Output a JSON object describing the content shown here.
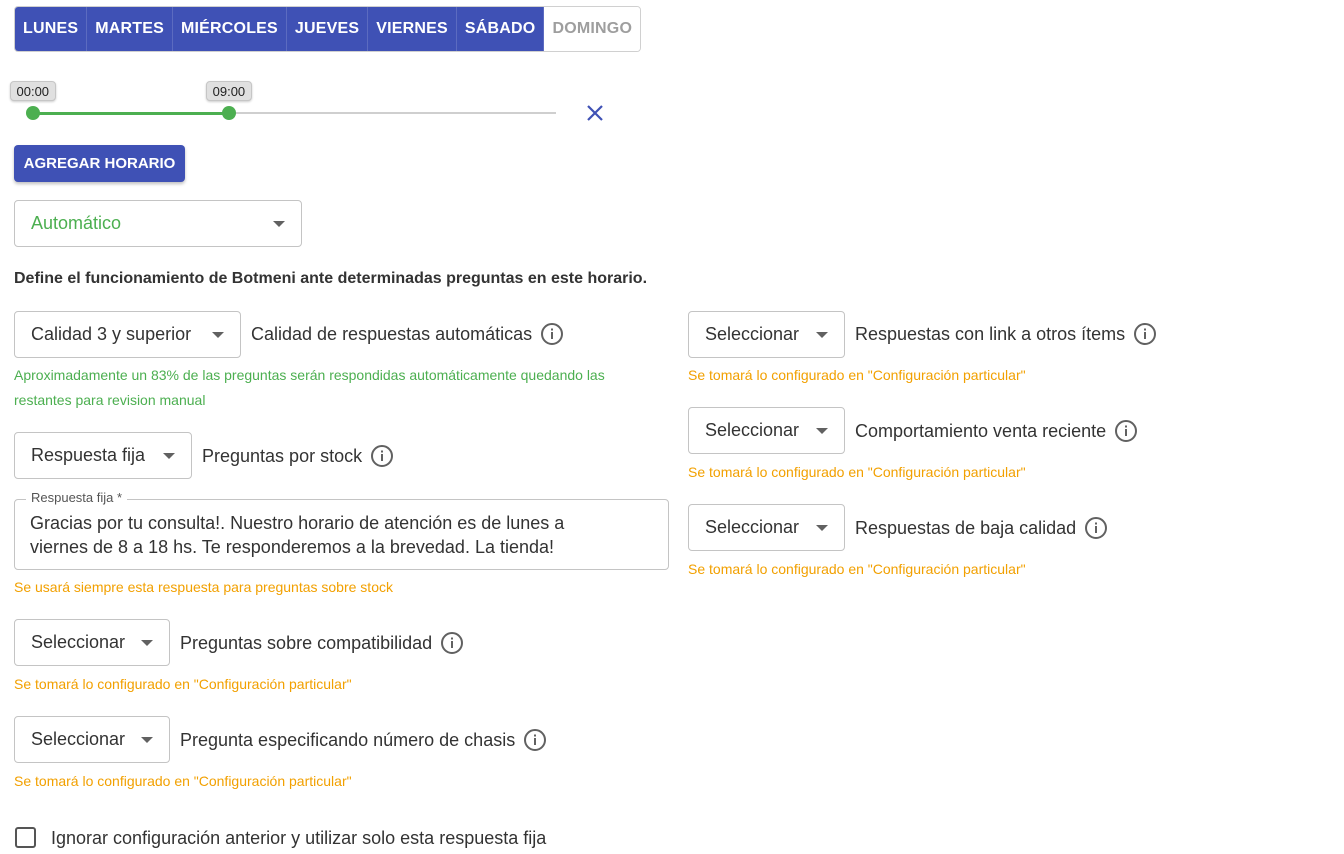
{
  "days": [
    {
      "label": "LUNES",
      "active": true
    },
    {
      "label": "MARTES",
      "active": true
    },
    {
      "label": "MIÉRCOLES",
      "active": true
    },
    {
      "label": "JUEVES",
      "active": true
    },
    {
      "label": "VIERNES",
      "active": true
    },
    {
      "label": "SÁBADO",
      "active": true
    },
    {
      "label": "DOMINGO",
      "active": false
    }
  ],
  "slider": {
    "start_label": "00:00",
    "end_label": "09:00",
    "start_fraction": 0.0,
    "end_fraction": 0.375
  },
  "add_schedule_label": "AGREGAR HORARIO",
  "mode_select": {
    "value": "Automático"
  },
  "description": "Define el funcionamiento de Botmeni ante determinadas preguntas en este horario.",
  "quality": {
    "select_value": "Calidad 3 y superior",
    "label": "Calidad de respuestas automáticas",
    "hint_line1": "Aproximadamente un 83% de las preguntas serán respondidas automáticamente quedando las",
    "hint_line2": "restantes para revision manual"
  },
  "stock": {
    "select_value": "Respuesta fija",
    "label": "Preguntas por stock",
    "field_label": "Respuesta fija *",
    "field_value_line1": "Gracias por tu consulta!. Nuestro horario de atención es de lunes a",
    "field_value_line2": "viernes de 8 a 18 hs. Te responderemos a la brevedad. La tienda!",
    "hint": "Se usará siempre esta respuesta para preguntas sobre stock"
  },
  "compat": {
    "select_value": "Seleccionar",
    "label": "Preguntas sobre compatibilidad",
    "hint": "Se tomará lo configurado en \"Configuración particular\""
  },
  "chasis": {
    "select_value": "Seleccionar",
    "label": "Pregunta especificando número de chasis",
    "hint": "Se tomará lo configurado en \"Configuración particular\""
  },
  "links": {
    "select_value": "Seleccionar",
    "label": "Respuestas con link a otros ítems",
    "hint": "Se tomará lo configurado en \"Configuración particular\""
  },
  "recent_sale": {
    "select_value": "Seleccionar",
    "label": "Comportamiento venta reciente",
    "hint": "Se tomará lo configurado en \"Configuración particular\""
  },
  "low_quality": {
    "select_value": "Seleccionar",
    "label": "Respuestas de baja calidad",
    "hint": "Se tomará lo configurado en \"Configuración particular\""
  },
  "ignore_checkbox": {
    "label": "Ignorar configuración anterior y utilizar solo esta respuesta fija",
    "checked": false
  },
  "colors": {
    "primary": "#3f51b5",
    "accent_green": "#4caf50",
    "hint_orange": "#f2a000"
  },
  "icons": {
    "close": "close-icon",
    "info": "info-icon",
    "dropdown": "caret-down-icon"
  }
}
